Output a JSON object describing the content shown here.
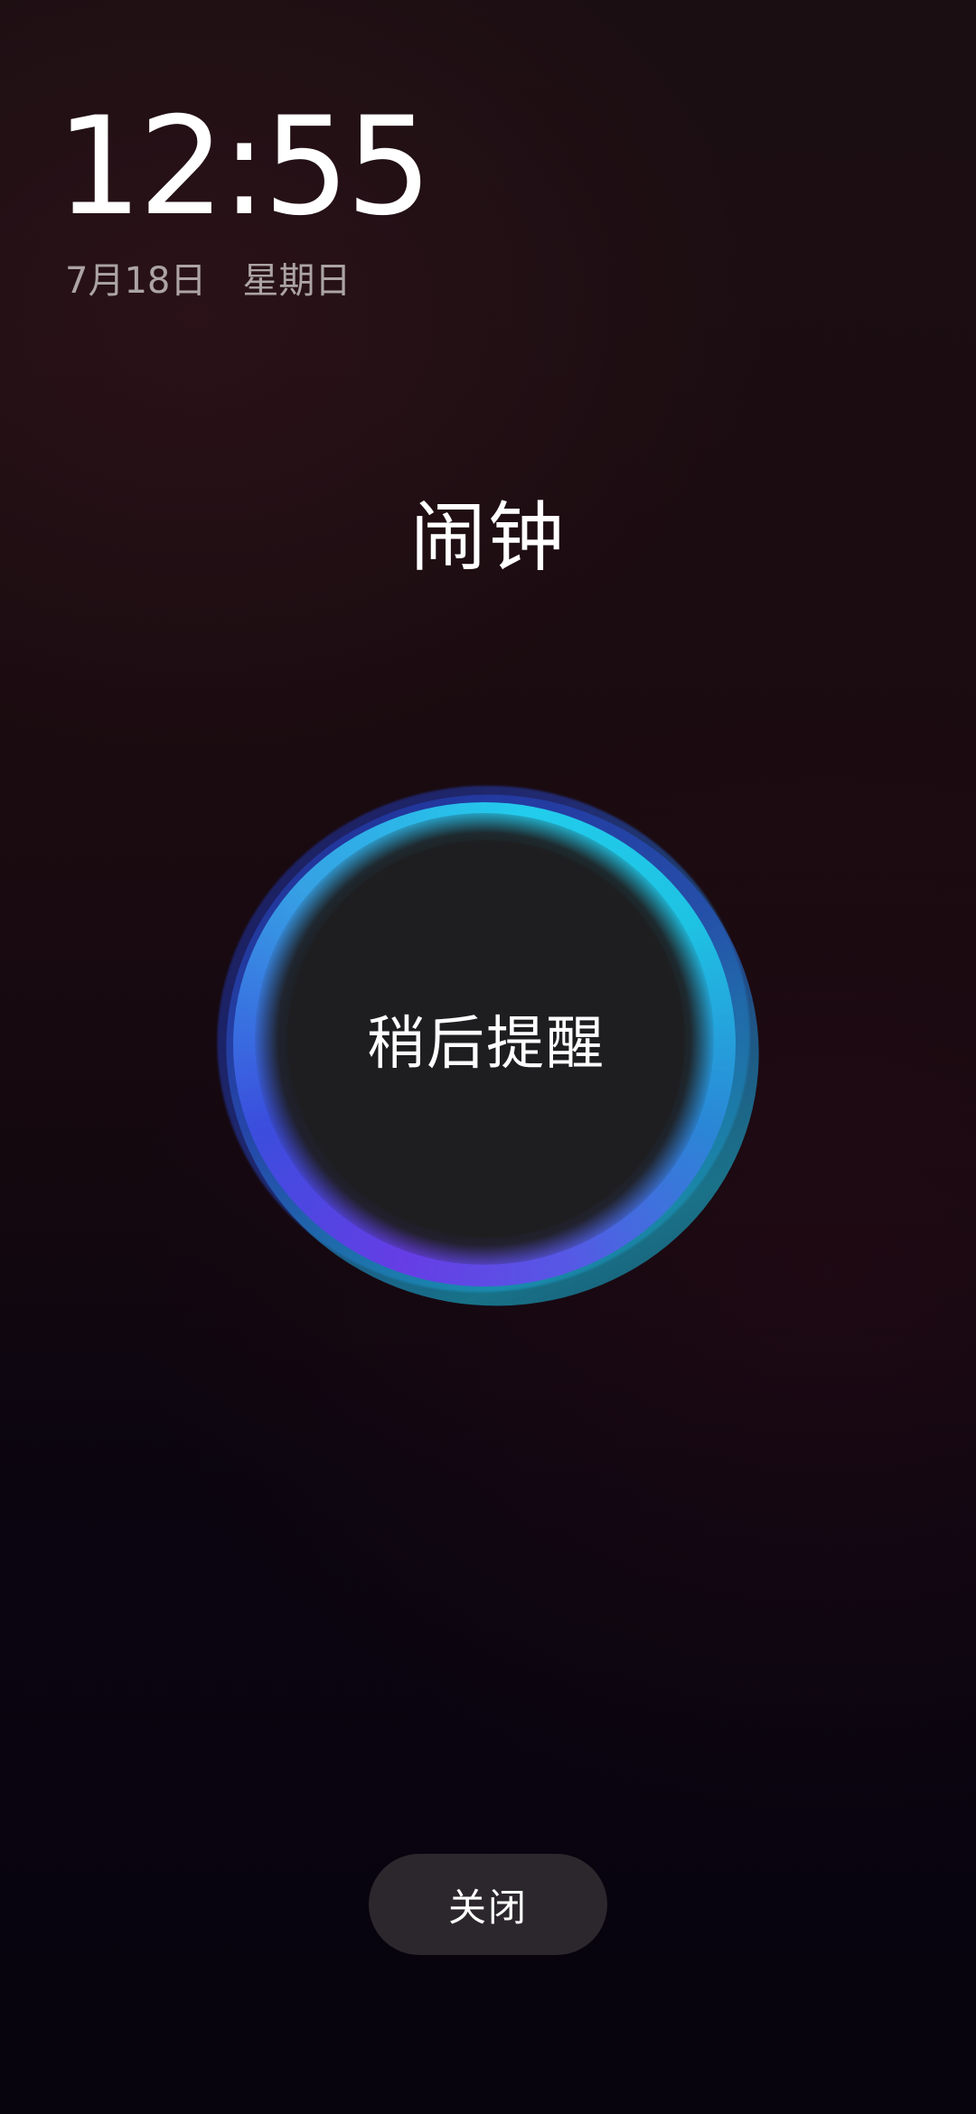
{
  "clock": {
    "time": "12:55",
    "date": "7月18日",
    "weekday": "星期日"
  },
  "alarm": {
    "title": "闹钟",
    "snooze_label": "稍后提醒",
    "close_label": "关闭"
  },
  "colors": {
    "ring_cyan": "#22d4f0",
    "ring_blue": "#2a5ad0",
    "ring_purple": "#6a3ae8",
    "center": "#1e1e20",
    "close_button_bg": "#2b272d"
  }
}
